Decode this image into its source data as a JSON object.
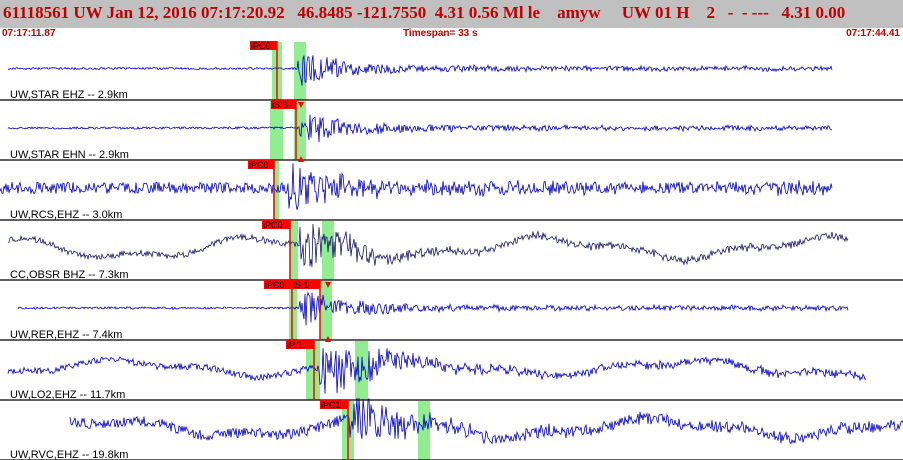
{
  "header": {
    "title": "61118561 UW Jan 12, 2016 07:17:20.92   46.8485 -121.7550  4.31 0.56 Ml le    amyw     UW 01 H    2   -  - ---   4.31 0.00",
    "time_start": "07:17:11.87",
    "timespan": "Timespan=  33 s",
    "time_end": "07:17:44.41"
  },
  "colors": {
    "title_bg": "#c0c0c0",
    "header_text": "#c00000",
    "trace_blue": "#0000cc",
    "trace_navy": "#1a1a6e",
    "pick_flag": "#ff0000",
    "window_band": "#90ee90"
  },
  "traces": [
    {
      "label": "UW,STAR EHZ -- 2.9km",
      "picks": [
        {
          "label": "iPC0"
        }
      ],
      "color": "blue",
      "noise": 0.04,
      "amp": 1.0,
      "wave": 0.0,
      "start": 0.0,
      "end": 1.0,
      "arrival": 0.47,
      "coda": 0.38
    },
    {
      "label": "UW,STAR EHN -- 2.9km",
      "picks": [
        {
          "label": "iS 0"
        }
      ],
      "color": "blue",
      "noise": 0.04,
      "amp": 1.0,
      "wave": 0.0,
      "start": 0.0,
      "end": 1.0,
      "arrival": 0.49,
      "coda": 0.38
    },
    {
      "label": "UW,RCS,EHZ -- 3.0km",
      "picks": [
        {
          "label": "iPC0"
        }
      ],
      "color": "blue",
      "noise": 0.22,
      "amp": 1.0,
      "wave": 0.0,
      "start": 0.0,
      "end": 1.0,
      "arrival": 0.46,
      "coda": 0.55
    },
    {
      "label": "CC,OBSR BHZ -- 7.3km",
      "picks": [
        {
          "label": "iPC0"
        }
      ],
      "color": "navy",
      "noise": 0.12,
      "amp": 0.75,
      "wave": 0.55,
      "start": 0.0,
      "end": 1.0,
      "arrival": 0.46,
      "coda": 0.9
    },
    {
      "label": "UW,RER,EHZ -- 7.4km",
      "picks": [
        {
          "label": "iPC0"
        },
        {
          "label": "iS 1"
        }
      ],
      "color": "blue",
      "noise": 0.04,
      "amp": 1.0,
      "wave": 0.0,
      "start": 0.0,
      "end": 1.0,
      "arrival": 0.47,
      "coda": 0.4
    },
    {
      "label": "UW,LO2,EHZ -- 11.7km",
      "picks": [
        {
          "label": "iP 1"
        }
      ],
      "color": "blue",
      "noise": 0.12,
      "amp": 1.0,
      "wave": 0.4,
      "start": 0.0,
      "end": 1.0,
      "arrival": 0.36,
      "coda": 0.8
    },
    {
      "label": "UW,RVC,EHZ -- 19.8km",
      "picks": [
        {
          "label": "iPC1"
        }
      ],
      "color": "blue",
      "noise": 0.2,
      "amp": 0.7,
      "wave": 0.45,
      "start": 0.0,
      "end": 1.0,
      "arrival": 0.42,
      "coda": 0.9
    }
  ]
}
